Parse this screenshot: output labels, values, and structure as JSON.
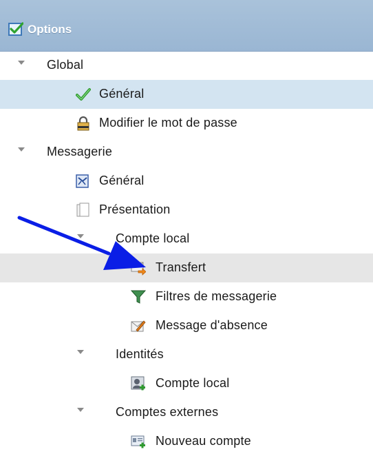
{
  "panel": {
    "title": "Options",
    "title_icon": "checked-box-icon"
  },
  "tree": {
    "global": {
      "label": "Global",
      "expanded": true
    },
    "global_general": {
      "label": "Général",
      "icon": "green-check-icon",
      "selected": true
    },
    "password": {
      "label": "Modifier le mot de passe",
      "icon": "padlock-icon"
    },
    "mail": {
      "label": "Messagerie",
      "expanded": true
    },
    "mail_general": {
      "label": "Général",
      "icon": "mail-settings-icon"
    },
    "presentation": {
      "label": "Présentation",
      "icon": "document-pages-icon"
    },
    "local_account": {
      "label": "Compte local",
      "expanded": true
    },
    "transfer": {
      "label": "Transfert",
      "icon": "mail-forward-icon",
      "highlighted": true
    },
    "filters": {
      "label": "Filtres de messagerie",
      "icon": "funnel-icon"
    },
    "absence": {
      "label": "Message d'absence",
      "icon": "mail-edit-icon"
    },
    "identities": {
      "label": "Identités",
      "expanded": true
    },
    "identity_local": {
      "label": "Compte local",
      "icon": "user-add-icon"
    },
    "external": {
      "label": "Comptes externes",
      "expanded": true
    },
    "new_account": {
      "label": "Nouveau compte",
      "icon": "card-add-icon"
    }
  },
  "colors": {
    "header": "#a9c2da",
    "selected_row": "#d3e4f1",
    "highlight_row": "#e6e6e6",
    "annotation_arrow": "#0a1ee6"
  }
}
